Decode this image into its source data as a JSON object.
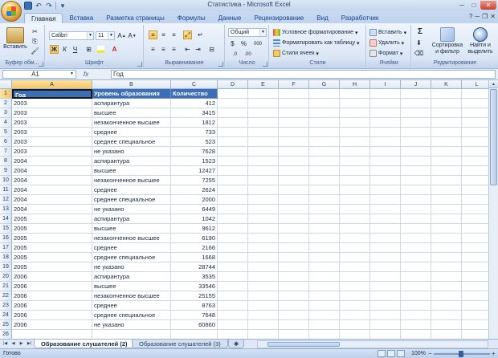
{
  "window": {
    "title": "Статистика - Microsoft Excel"
  },
  "tabs": [
    "Главная",
    "Вставка",
    "Разметка страницы",
    "Формулы",
    "Данные",
    "Рецензирование",
    "Вид",
    "Разработчик"
  ],
  "active_tab": "Главная",
  "ribbon": {
    "clipboard": {
      "label": "Буфер обм...",
      "paste": "Вставить"
    },
    "font": {
      "label": "Шрифт",
      "family": "Calibri",
      "size": "11",
      "bold": "Ж",
      "italic": "К",
      "underline": "Ч"
    },
    "alignment": {
      "label": "Выравнивание"
    },
    "number": {
      "label": "Число",
      "format": "Общий",
      "percent": "%",
      "thousands": "000"
    },
    "styles": {
      "label": "Стили",
      "conditional": "Условное форматирование",
      "as_table": "Форматировать как таблицу",
      "cell_styles": "Стили ячеек"
    },
    "cells": {
      "label": "Ячейки",
      "insert": "Вставить",
      "delete": "Удалить",
      "format": "Формат"
    },
    "editing": {
      "label": "Редактирование",
      "sum": "Σ",
      "sort": "Сортировка и фильтр",
      "find": "Найти и выделить"
    }
  },
  "formula_bar": {
    "name_box": "A1",
    "fx": "fx",
    "content": "Год"
  },
  "columns": [
    "A",
    "B",
    "C",
    "D",
    "E",
    "F",
    "G",
    "H",
    "I",
    "J",
    "K",
    "L"
  ],
  "header_row": [
    "Год",
    "Уровень образования",
    "Количество"
  ],
  "rows": [
    [
      "2003",
      "аспирантура",
      "412"
    ],
    [
      "2003",
      "высшее",
      "3415"
    ],
    [
      "2003",
      "незаконченное высшее",
      "1812"
    ],
    [
      "2003",
      "среднее",
      "733"
    ],
    [
      "2003",
      "среднее специальное",
      "523"
    ],
    [
      "2003",
      "не указано",
      "7628"
    ],
    [
      "2004",
      "аспирантура",
      "1523"
    ],
    [
      "2004",
      "высшее",
      "12427"
    ],
    [
      "2004",
      "незаконченное высшее",
      "7255"
    ],
    [
      "2004",
      "среднее",
      "2624"
    ],
    [
      "2004",
      "среднее специальное",
      "2000"
    ],
    [
      "2004",
      "не указано",
      "6449"
    ],
    [
      "2005",
      "аспирантура",
      "1042"
    ],
    [
      "2005",
      "высшее",
      "9612"
    ],
    [
      "2005",
      "незаконченное высшее",
      "6190"
    ],
    [
      "2005",
      "среднее",
      "2166"
    ],
    [
      "2005",
      "среднее специальное",
      "1668"
    ],
    [
      "2005",
      "не указано",
      "28744"
    ],
    [
      "2006",
      "аспирантура",
      "3535"
    ],
    [
      "2006",
      "высшее",
      "33546"
    ],
    [
      "2006",
      "незаконченное высшее",
      "25155"
    ],
    [
      "2006",
      "среднее",
      "8763"
    ],
    [
      "2006",
      "среднее специальное",
      "7648"
    ],
    [
      "2006",
      "не указано",
      "60860"
    ]
  ],
  "sheets": [
    "Образование слушателей (2)",
    "Образование слушателей (3)"
  ],
  "active_sheet": "Образование слушателей (2)",
  "status": {
    "ready": "Готово",
    "zoom": "100%"
  },
  "colors": {
    "header_fill": "#3c6fb5",
    "header_text": "#ffffff"
  }
}
